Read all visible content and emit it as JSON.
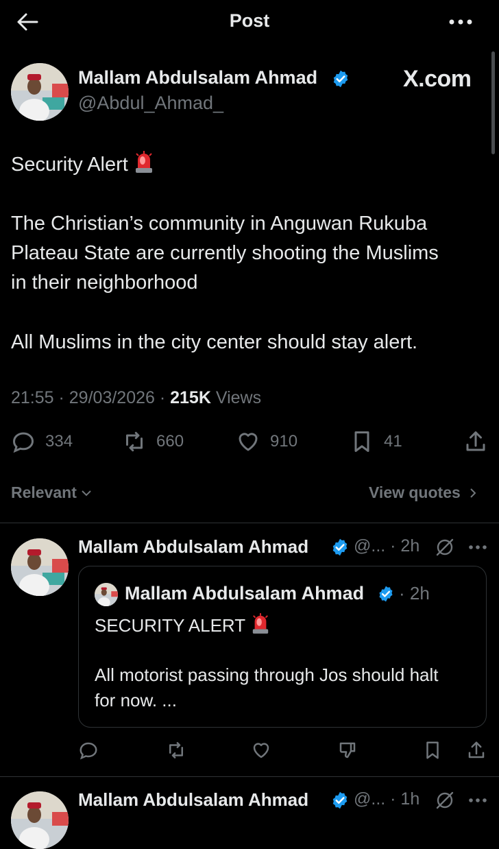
{
  "header": {
    "title": "Post",
    "back_icon": "back-arrow-icon",
    "more_icon": "more-dots-icon"
  },
  "main_post": {
    "author_name": "Mallam Abdulsalam Ahmad",
    "handle": "@Abdul_Ahmad_",
    "watermark": "X.com",
    "lines": [
      "Security Alert",
      "The Christian’s community in Anguwan Rukuba",
      "Plateau State are currently shooting the Muslims",
      "in their neighborhood",
      "All Muslims in the city center should stay alert."
    ],
    "time": "21:55",
    "date": "29/03/2026",
    "views_count": "215K",
    "views_label": "Views",
    "replies": "334",
    "reposts": "660",
    "likes": "910",
    "bookmarks": "41"
  },
  "sort": {
    "relevant_label": "Relevant",
    "view_quotes_label": "View quotes"
  },
  "replies": [
    {
      "author_name": "Mallam Abdulsalam Ahmad",
      "handle_time": "@... · 2h",
      "quote": {
        "author_name": "Mallam Abdulsalam Ahmad",
        "time": "· 2h",
        "line1": "SECURITY ALERT",
        "line2": "All motorist passing through Jos should halt",
        "line3": "for now. ..."
      }
    },
    {
      "author_name": "Mallam Abdulsalam Ahmad",
      "handle_time": "@... · 1h"
    }
  ],
  "colors": {
    "background": "#000000",
    "text": "#e7e9ea",
    "muted": "#71767b",
    "verified": "#1d9bf0",
    "divider": "#2f3336",
    "siren_red": "#e0282e"
  }
}
